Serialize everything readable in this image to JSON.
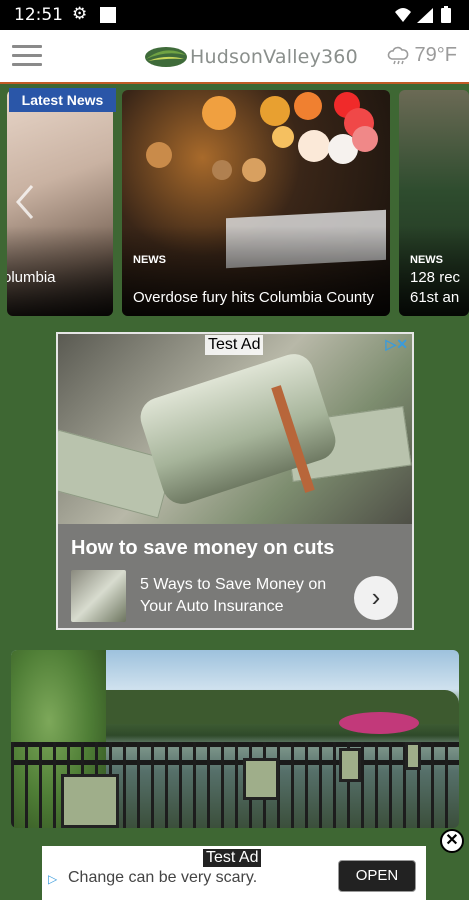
{
  "status_bar": {
    "time": "12:51"
  },
  "app_bar": {
    "logo_text": "HudsonValley360",
    "temperature": "79°F"
  },
  "carousel": {
    "badge": "Latest News",
    "cards": [
      {
        "tag": "",
        "headline": "olumbia"
      },
      {
        "tag": "NEWS",
        "headline": "Overdose fury hits Columbia County"
      },
      {
        "tag": "NEWS",
        "headline": "128 rec 61st an"
      }
    ]
  },
  "ad1": {
    "label": "Test Ad",
    "title": "How to save money on cuts",
    "subtitle": "5 Ways to Save Money on Your Auto Insurance",
    "cta_icon": "chevron-right-icon"
  },
  "ad2": {
    "label": "Test Ad",
    "text": "Change can be very scary.",
    "button": "OPEN"
  },
  "colors": {
    "page_background": "#3e6733",
    "app_bar_accent": "#c25a26",
    "badge": "#2a56a8",
    "adchoices": "#3a9bdc"
  }
}
